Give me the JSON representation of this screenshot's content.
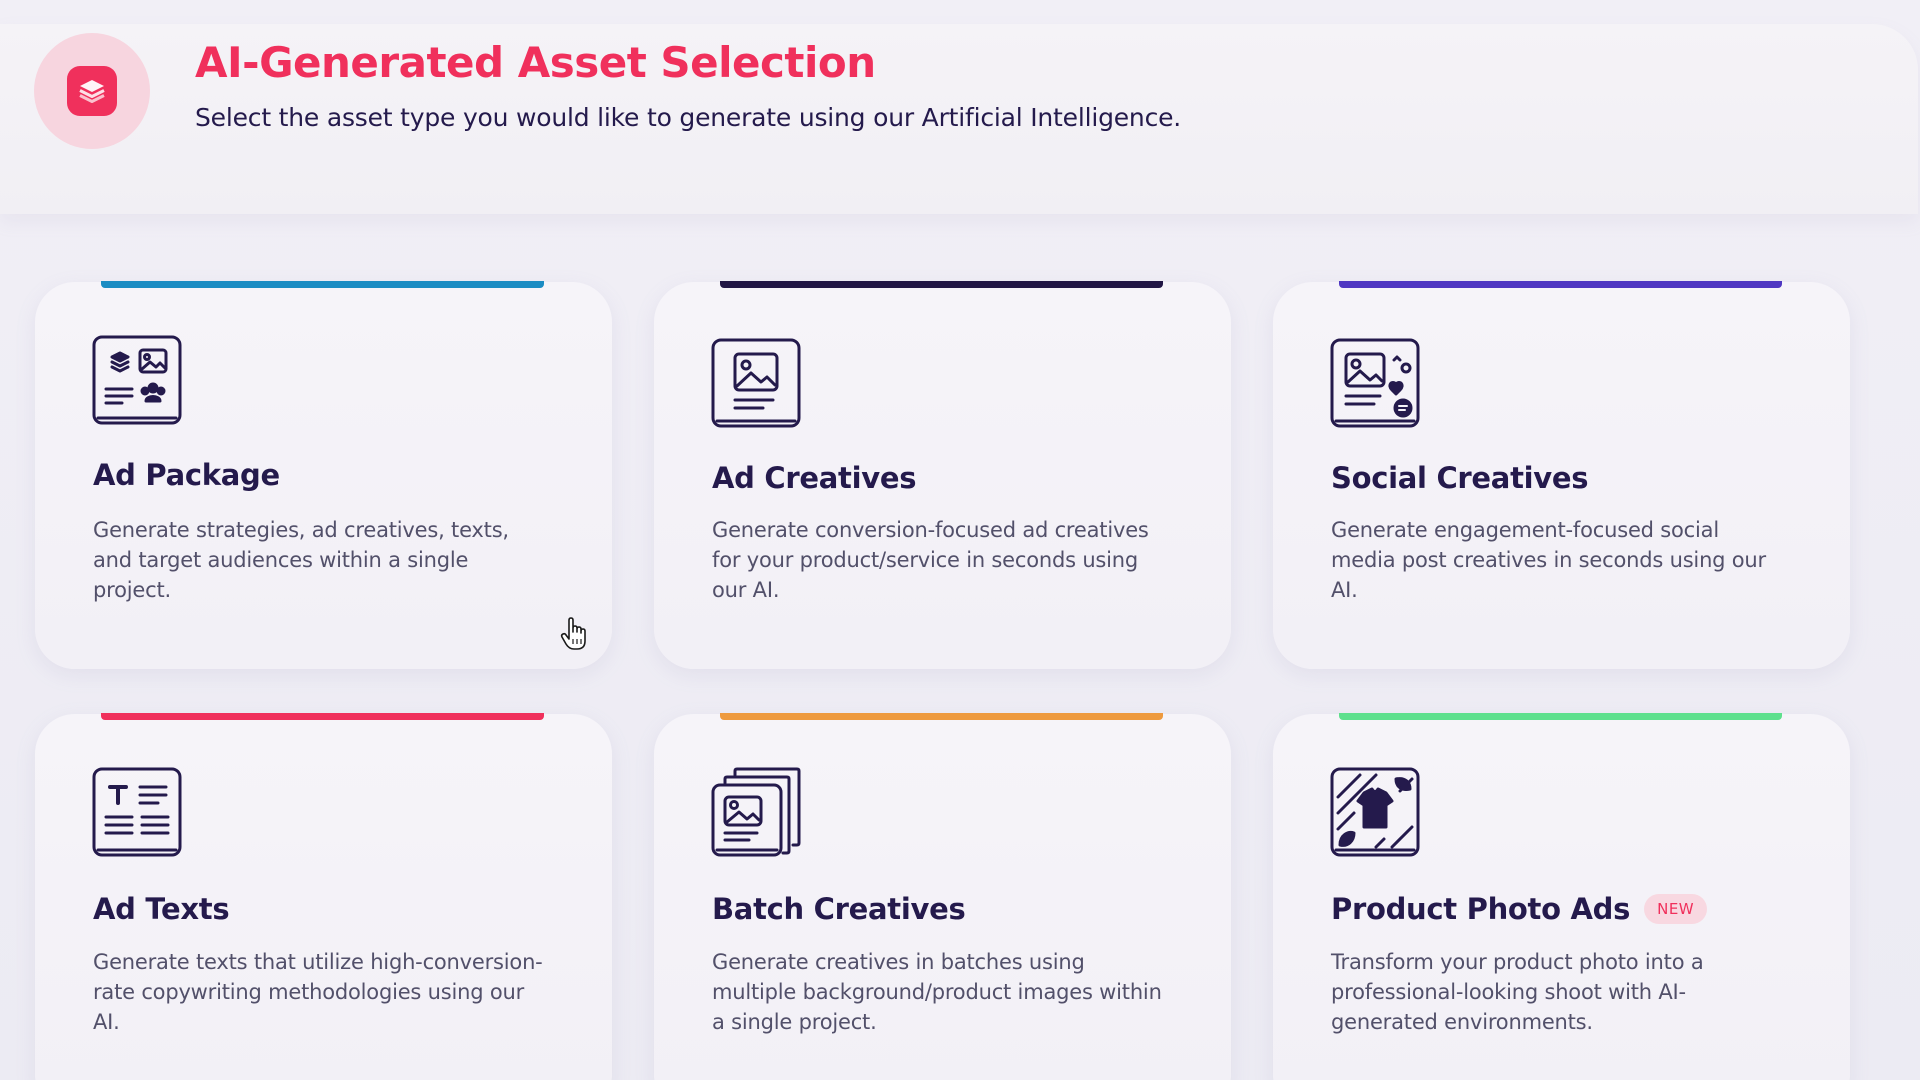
{
  "header": {
    "title": "AI-Generated Asset Selection",
    "subtitle": "Select the asset type you would like to generate using our Artificial Intelligence.",
    "logo_icon": "layers-icon",
    "brand_color": "#f0305c"
  },
  "cards": [
    {
      "title": "Ad Package",
      "description": "Generate strategies, ad creatives, texts, and target audiences within a single project.",
      "icon": "ad-package-icon",
      "accent_color": "#1b8cc3"
    },
    {
      "title": "Ad Creatives",
      "description": "Generate conversion-focused ad creatives for your product/service in seconds using our AI.",
      "icon": "image-document-icon",
      "accent_color": "#211645"
    },
    {
      "title": "Social Creatives",
      "description": "Generate engagement-focused social media post creatives in seconds using our AI.",
      "icon": "social-post-icon",
      "accent_color": "#4f37c2"
    },
    {
      "title": "Ad Texts",
      "description": "Generate texts that utilize high-conversion-rate copywriting methodologies using our AI.",
      "icon": "text-document-icon",
      "accent_color": "#f0305c"
    },
    {
      "title": "Batch Creatives",
      "description": "Generate creatives in batches using multiple background/product images within a single project.",
      "icon": "stacked-images-icon",
      "accent_color": "#ee9a3e"
    },
    {
      "title": "Product Photo Ads",
      "badge": "NEW",
      "description": "Transform your product photo into a professional-looking shoot with AI-generated environments.",
      "icon": "product-photo-icon",
      "accent_color": "#5ee08d"
    }
  ],
  "text_color": "#241a4c"
}
